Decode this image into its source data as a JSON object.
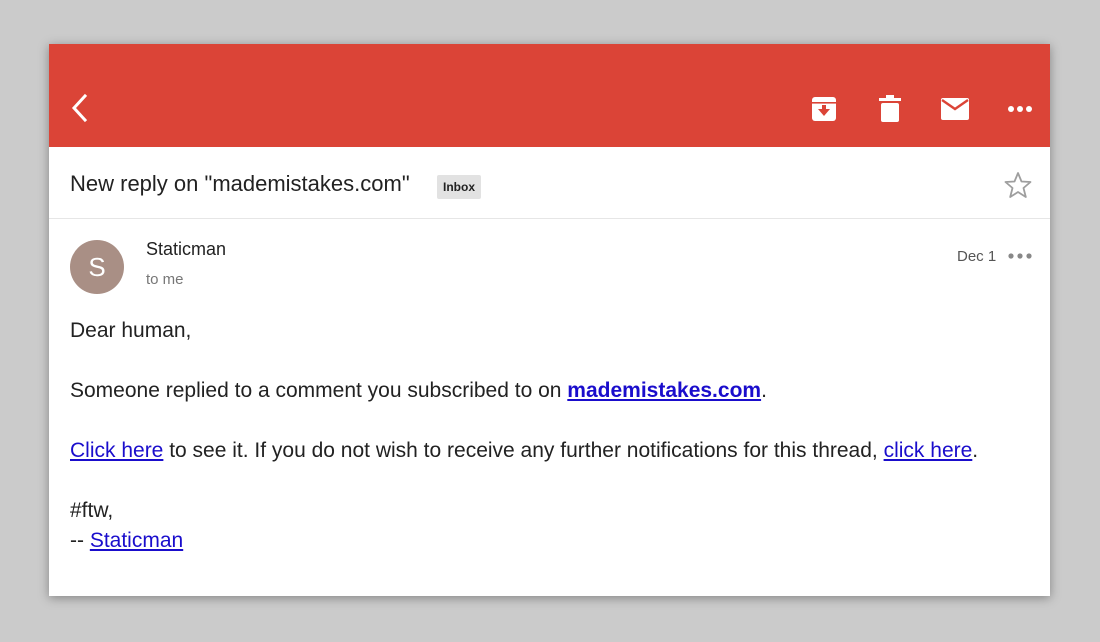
{
  "toolbar": {
    "icons": [
      "back-icon",
      "archive-icon",
      "delete-icon",
      "mail-icon",
      "more-vert-icon"
    ],
    "color": "#db4437"
  },
  "subject": {
    "title": "New reply on \"mademistakes.com\"",
    "label": "Inbox"
  },
  "message": {
    "avatar_letter": "S",
    "sender": "Staticman",
    "recipient": "to me",
    "date": "Dec 1"
  },
  "body": {
    "greeting": "Dear human,",
    "line1_prefix": "Someone replied to a comment you subscribed to on ",
    "line1_link": "mademistakes.com",
    "line1_suffix": ".",
    "line2_link1": "Click here",
    "line2_middle": " to see it. If you do not wish to receive any further notifications for this thread, ",
    "line2_link2": "click here",
    "line2_suffix": ".",
    "signoff": "#ftw,",
    "sig_prefix": "-- ",
    "sig_link": "Staticman"
  }
}
